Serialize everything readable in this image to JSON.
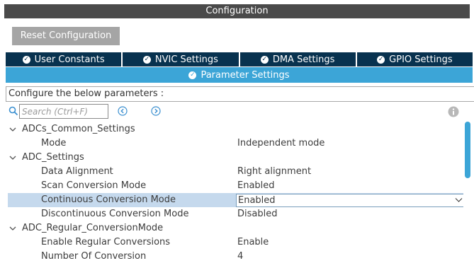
{
  "window": {
    "title": "Configuration"
  },
  "toolbar": {
    "reset_label": "Reset Configuration"
  },
  "tabs": [
    {
      "label": "User Constants"
    },
    {
      "label": "NVIC Settings"
    },
    {
      "label": "DMA Settings"
    },
    {
      "label": "GPIO Settings"
    }
  ],
  "active_tab": {
    "label": "Parameter Settings"
  },
  "configure_text": "Configure the below parameters :",
  "search": {
    "placeholder": "Search (Ctrl+F)",
    "value": ""
  },
  "tree": {
    "groups": [
      {
        "label": "ADCs_Common_Settings",
        "params": [
          {
            "label": "Mode",
            "value": "Independent mode"
          }
        ]
      },
      {
        "label": "ADC_Settings",
        "params": [
          {
            "label": "Data Alignment",
            "value": "Right alignment"
          },
          {
            "label": "Scan Conversion Mode",
            "value": "Enabled"
          },
          {
            "label": "Continuous Conversion Mode",
            "value": "Enabled",
            "selected": true
          },
          {
            "label": "Discontinuous Conversion Mode",
            "value": "Disabled"
          }
        ]
      },
      {
        "label": "ADC_Regular_ConversionMode",
        "params": [
          {
            "label": "Enable Regular Conversions",
            "value": "Enable"
          },
          {
            "label": "Number Of Conversion",
            "value": "4"
          }
        ]
      }
    ]
  },
  "colors": {
    "title_bg": "#4a4a4a",
    "tab_bg": "#08324f",
    "active_tab_bg": "#3ca5d7",
    "selected_row_bg": "#c5d9ed",
    "button_bg": "#a5a5a5"
  },
  "icons": [
    "search-icon",
    "arrow-left-circle-icon",
    "arrow-right-circle-icon",
    "info-icon",
    "check-circle-icon",
    "chevron-down-icon"
  ]
}
